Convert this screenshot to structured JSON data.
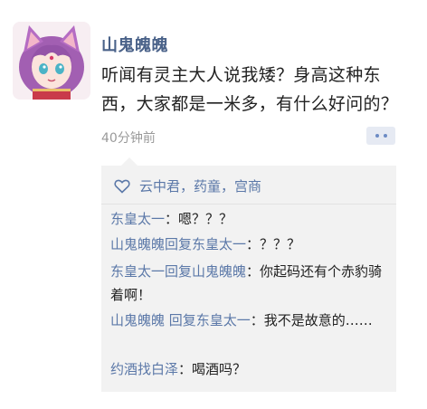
{
  "post": {
    "username": "山鬼魄魄",
    "text": "听闻有灵主大人说我矮？身高这种东西，大家都是一米多，有什么好问的？",
    "time": "40分钟前"
  },
  "likes": {
    "names": "云中君，药童，宫商"
  },
  "replies": [
    {
      "from": "东皇太一",
      "sep": "：",
      "text": "嗯？？？"
    },
    {
      "from": "山鬼魄魄回复东皇太一",
      "sep": "：",
      "text": "？？？"
    },
    {
      "from": "东皇太一回复山鬼魄魄",
      "sep": "：",
      "text": "你起码还有个赤豹骑着啊！"
    },
    {
      "from": "山鬼魄魄 回复东皇太一",
      "sep": "：",
      "text": "我不是故意的……"
    },
    {
      "from": "约酒找白泽",
      "sep": "：",
      "text": "喝酒吗？"
    }
  ],
  "colors": {
    "link": "#5b78a8",
    "username": "#4a6289",
    "reply_bg": "#f2f2f2"
  },
  "icons": {
    "avatar": "avatar-illustration",
    "like": "heart-outline-icon",
    "comment": "comment-dots-icon"
  }
}
